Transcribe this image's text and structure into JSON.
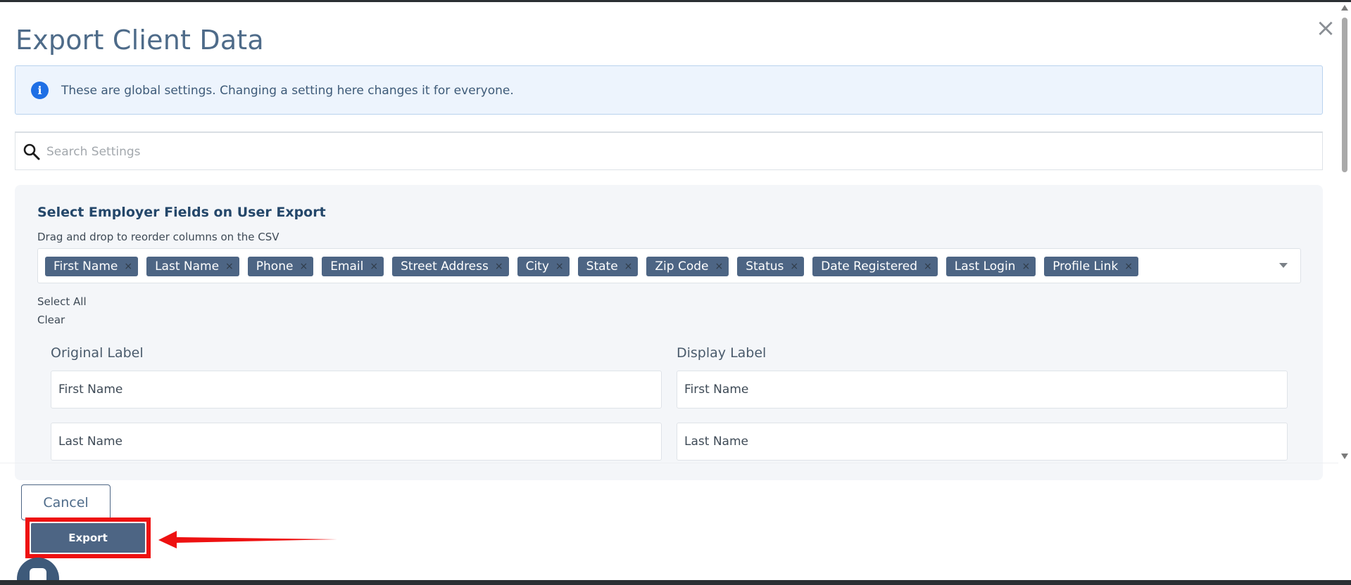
{
  "modal": {
    "title": "Export Client Data",
    "close_glyph": "×"
  },
  "info": {
    "icon_glyph": "i",
    "text": "These are global settings. Changing a setting here changes it for everyone."
  },
  "search": {
    "placeholder": "Search Settings",
    "value": ""
  },
  "fields_panel": {
    "title": "Select Employer Fields on User Export",
    "subtitle": "Drag and drop to reorder columns on the CSV",
    "tags": [
      "First Name",
      "Last Name",
      "Phone",
      "Email",
      "Street Address",
      "City",
      "State",
      "Zip Code",
      "Status",
      "Date Registered",
      "Last Login",
      "Profile Link"
    ],
    "tag_remove_glyph": "×",
    "select_all_label": "Select All",
    "clear_label": "Clear",
    "original_label_header": "Original Label",
    "display_label_header": "Display Label",
    "rows": [
      {
        "original": "First Name",
        "display": "First Name"
      },
      {
        "original": "Last Name",
        "display": "Last Name"
      }
    ]
  },
  "footer": {
    "cancel_label": "Cancel",
    "export_label": "Export"
  },
  "colors": {
    "accent": "#4d6584",
    "title": "#4e6b89",
    "info_background": "#edf4fd",
    "info_icon": "#1f6fe5",
    "annotation_red": "#ee1111"
  }
}
